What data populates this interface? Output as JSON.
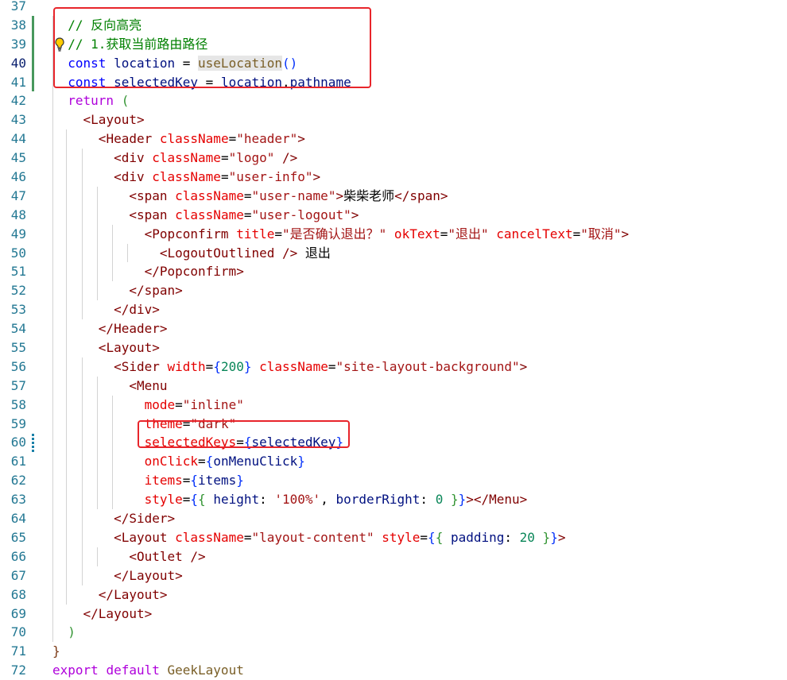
{
  "editor": {
    "lines": [
      {
        "n": "37",
        "tokens": []
      },
      {
        "n": "38",
        "tokens": [
          {
            "t": "// 反向高亮",
            "c": "cmt"
          }
        ]
      },
      {
        "n": "39",
        "tokens": [
          {
            "t": "// 1.获取当前路由路径",
            "c": "cmt"
          }
        ]
      },
      {
        "n": "40",
        "active": true,
        "tokens": [
          {
            "t": "const ",
            "c": "kw"
          },
          {
            "t": "location",
            "c": "var"
          },
          {
            "t": " = ",
            "c": "txt"
          },
          {
            "t": "useLocation",
            "c": "fn wordhl"
          },
          {
            "t": "()",
            "c": "br1"
          }
        ]
      },
      {
        "n": "41",
        "tokens": [
          {
            "t": "const ",
            "c": "kw"
          },
          {
            "t": "selectedKey",
            "c": "var"
          },
          {
            "t": " = ",
            "c": "txt"
          },
          {
            "t": "location",
            "c": "var"
          },
          {
            "t": ".",
            "c": "txt"
          },
          {
            "t": "pathname",
            "c": "var"
          }
        ]
      },
      {
        "n": "42",
        "tokens": [
          {
            "t": "return ",
            "c": "ctrl"
          },
          {
            "t": "(",
            "c": "br2"
          }
        ]
      },
      {
        "n": "43",
        "tokens": [
          {
            "t": "  <",
            "c": "tag"
          },
          {
            "t": "Layout",
            "c": "tag"
          },
          {
            "t": ">",
            "c": "tag"
          }
        ]
      },
      {
        "n": "44",
        "tokens": [
          {
            "t": "    <",
            "c": "tag"
          },
          {
            "t": "Header ",
            "c": "tag"
          },
          {
            "t": "className",
            "c": "attr"
          },
          {
            "t": "=",
            "c": "txt"
          },
          {
            "t": "\"header\"",
            "c": "str"
          },
          {
            "t": ">",
            "c": "tag"
          }
        ]
      },
      {
        "n": "45",
        "tokens": [
          {
            "t": "      <",
            "c": "tag"
          },
          {
            "t": "div ",
            "c": "tag"
          },
          {
            "t": "className",
            "c": "attr"
          },
          {
            "t": "=",
            "c": "txt"
          },
          {
            "t": "\"logo\"",
            "c": "str"
          },
          {
            "t": " />",
            "c": "tag"
          }
        ]
      },
      {
        "n": "46",
        "tokens": [
          {
            "t": "      <",
            "c": "tag"
          },
          {
            "t": "div ",
            "c": "tag"
          },
          {
            "t": "className",
            "c": "attr"
          },
          {
            "t": "=",
            "c": "txt"
          },
          {
            "t": "\"user-info\"",
            "c": "str"
          },
          {
            "t": ">",
            "c": "tag"
          }
        ]
      },
      {
        "n": "47",
        "tokens": [
          {
            "t": "        <",
            "c": "tag"
          },
          {
            "t": "span ",
            "c": "tag"
          },
          {
            "t": "className",
            "c": "attr"
          },
          {
            "t": "=",
            "c": "txt"
          },
          {
            "t": "\"user-name\"",
            "c": "str"
          },
          {
            "t": ">",
            "c": "tag"
          },
          {
            "t": "柴柴老师",
            "c": "txt"
          },
          {
            "t": "</",
            "c": "tag"
          },
          {
            "t": "span",
            "c": "tag"
          },
          {
            "t": ">",
            "c": "tag"
          }
        ]
      },
      {
        "n": "48",
        "tokens": [
          {
            "t": "        <",
            "c": "tag"
          },
          {
            "t": "span ",
            "c": "tag"
          },
          {
            "t": "className",
            "c": "attr"
          },
          {
            "t": "=",
            "c": "txt"
          },
          {
            "t": "\"user-logout\"",
            "c": "str"
          },
          {
            "t": ">",
            "c": "tag"
          }
        ]
      },
      {
        "n": "49",
        "tokens": [
          {
            "t": "          <",
            "c": "tag"
          },
          {
            "t": "Popconfirm ",
            "c": "tag"
          },
          {
            "t": "title",
            "c": "attr"
          },
          {
            "t": "=",
            "c": "txt"
          },
          {
            "t": "\"是否确认退出？\"",
            "c": "str"
          },
          {
            "t": " okText",
            "c": "attr"
          },
          {
            "t": "=",
            "c": "txt"
          },
          {
            "t": "\"退出\"",
            "c": "str"
          },
          {
            "t": " cancelText",
            "c": "attr"
          },
          {
            "t": "=",
            "c": "txt"
          },
          {
            "t": "\"取消\"",
            "c": "str"
          },
          {
            "t": ">",
            "c": "tag"
          }
        ]
      },
      {
        "n": "50",
        "tokens": [
          {
            "t": "            <",
            "c": "tag"
          },
          {
            "t": "LogoutOutlined ",
            "c": "tag"
          },
          {
            "t": "/>",
            "c": "tag"
          },
          {
            "t": " 退出",
            "c": "txt"
          }
        ]
      },
      {
        "n": "51",
        "tokens": [
          {
            "t": "          </",
            "c": "tag"
          },
          {
            "t": "Popconfirm",
            "c": "tag"
          },
          {
            "t": ">",
            "c": "tag"
          }
        ]
      },
      {
        "n": "52",
        "tokens": [
          {
            "t": "        </",
            "c": "tag"
          },
          {
            "t": "span",
            "c": "tag"
          },
          {
            "t": ">",
            "c": "tag"
          }
        ]
      },
      {
        "n": "53",
        "tokens": [
          {
            "t": "      </",
            "c": "tag"
          },
          {
            "t": "div",
            "c": "tag"
          },
          {
            "t": ">",
            "c": "tag"
          }
        ]
      },
      {
        "n": "54",
        "tokens": [
          {
            "t": "    </",
            "c": "tag"
          },
          {
            "t": "Header",
            "c": "tag"
          },
          {
            "t": ">",
            "c": "tag"
          }
        ]
      },
      {
        "n": "55",
        "tokens": [
          {
            "t": "    <",
            "c": "tag"
          },
          {
            "t": "Layout",
            "c": "tag"
          },
          {
            "t": ">",
            "c": "tag"
          }
        ]
      },
      {
        "n": "56",
        "tokens": [
          {
            "t": "      <",
            "c": "tag"
          },
          {
            "t": "Sider ",
            "c": "tag"
          },
          {
            "t": "width",
            "c": "attr"
          },
          {
            "t": "=",
            "c": "txt"
          },
          {
            "t": "{",
            "c": "br1"
          },
          {
            "t": "200",
            "c": "num"
          },
          {
            "t": "}",
            "c": "br1"
          },
          {
            "t": " className",
            "c": "attr"
          },
          {
            "t": "=",
            "c": "txt"
          },
          {
            "t": "\"site-layout-background\"",
            "c": "str"
          },
          {
            "t": ">",
            "c": "tag"
          }
        ]
      },
      {
        "n": "57",
        "tokens": [
          {
            "t": "        <",
            "c": "tag"
          },
          {
            "t": "Menu",
            "c": "tag"
          }
        ]
      },
      {
        "n": "58",
        "tokens": [
          {
            "t": "          mode",
            "c": "attr"
          },
          {
            "t": "=",
            "c": "txt"
          },
          {
            "t": "\"inline\"",
            "c": "str"
          }
        ]
      },
      {
        "n": "59",
        "tokens": [
          {
            "t": "          theme",
            "c": "attr"
          },
          {
            "t": "=",
            "c": "txt"
          },
          {
            "t": "\"dark\"",
            "c": "str"
          }
        ]
      },
      {
        "n": "60",
        "tokens": [
          {
            "t": "          selectedKeys",
            "c": "attr"
          },
          {
            "t": "=",
            "c": "txt"
          },
          {
            "t": "{",
            "c": "br1"
          },
          {
            "t": "selectedKey",
            "c": "var"
          },
          {
            "t": "}",
            "c": "br1"
          }
        ]
      },
      {
        "n": "61",
        "tokens": [
          {
            "t": "          onClick",
            "c": "attr"
          },
          {
            "t": "=",
            "c": "txt"
          },
          {
            "t": "{",
            "c": "br1"
          },
          {
            "t": "onMenuClick",
            "c": "var"
          },
          {
            "t": "}",
            "c": "br1"
          }
        ]
      },
      {
        "n": "62",
        "tokens": [
          {
            "t": "          items",
            "c": "attr"
          },
          {
            "t": "=",
            "c": "txt"
          },
          {
            "t": "{",
            "c": "br1"
          },
          {
            "t": "items",
            "c": "var"
          },
          {
            "t": "}",
            "c": "br1"
          }
        ]
      },
      {
        "n": "63",
        "tokens": [
          {
            "t": "          style",
            "c": "attr"
          },
          {
            "t": "=",
            "c": "txt"
          },
          {
            "t": "{",
            "c": "br1"
          },
          {
            "t": "{",
            "c": "br2"
          },
          {
            "t": " height",
            "c": "var"
          },
          {
            "t": ": ",
            "c": "txt"
          },
          {
            "t": "'100%'",
            "c": "str"
          },
          {
            "t": ", ",
            "c": "txt"
          },
          {
            "t": "borderRight",
            "c": "var"
          },
          {
            "t": ": ",
            "c": "txt"
          },
          {
            "t": "0",
            "c": "num"
          },
          {
            "t": " }",
            "c": "br2"
          },
          {
            "t": "}",
            "c": "br1"
          },
          {
            "t": "></",
            "c": "tag"
          },
          {
            "t": "Menu",
            "c": "tag"
          },
          {
            "t": ">",
            "c": "tag"
          }
        ]
      },
      {
        "n": "64",
        "tokens": [
          {
            "t": "      </",
            "c": "tag"
          },
          {
            "t": "Sider",
            "c": "tag"
          },
          {
            "t": ">",
            "c": "tag"
          }
        ]
      },
      {
        "n": "65",
        "tokens": [
          {
            "t": "      <",
            "c": "tag"
          },
          {
            "t": "Layout ",
            "c": "tag"
          },
          {
            "t": "className",
            "c": "attr"
          },
          {
            "t": "=",
            "c": "txt"
          },
          {
            "t": "\"layout-content\"",
            "c": "str"
          },
          {
            "t": " style",
            "c": "attr"
          },
          {
            "t": "=",
            "c": "txt"
          },
          {
            "t": "{",
            "c": "br1"
          },
          {
            "t": "{",
            "c": "br2"
          },
          {
            "t": " padding",
            "c": "var"
          },
          {
            "t": ": ",
            "c": "txt"
          },
          {
            "t": "20",
            "c": "num"
          },
          {
            "t": " }",
            "c": "br2"
          },
          {
            "t": "}",
            "c": "br1"
          },
          {
            "t": ">",
            "c": "tag"
          }
        ]
      },
      {
        "n": "66",
        "tokens": [
          {
            "t": "        <",
            "c": "tag"
          },
          {
            "t": "Outlet ",
            "c": "tag"
          },
          {
            "t": "/>",
            "c": "tag"
          }
        ]
      },
      {
        "n": "67",
        "tokens": [
          {
            "t": "      </",
            "c": "tag"
          },
          {
            "t": "Layout",
            "c": "tag"
          },
          {
            "t": ">",
            "c": "tag"
          }
        ]
      },
      {
        "n": "68",
        "tokens": [
          {
            "t": "    </",
            "c": "tag"
          },
          {
            "t": "Layout",
            "c": "tag"
          },
          {
            "t": ">",
            "c": "tag"
          }
        ]
      },
      {
        "n": "69",
        "tokens": [
          {
            "t": "  </",
            "c": "tag"
          },
          {
            "t": "Layout",
            "c": "tag"
          },
          {
            "t": ">",
            "c": "tag"
          }
        ]
      },
      {
        "n": "70",
        "tokens": [
          {
            "t": ")",
            "c": "br2"
          }
        ]
      },
      {
        "n": "71",
        "indent": 0,
        "tokens": [
          {
            "t": "}",
            "c": "br3"
          }
        ]
      },
      {
        "n": "72",
        "indent": 0,
        "tokens": [
          {
            "t": "export ",
            "c": "ctrl"
          },
          {
            "t": "default ",
            "c": "ctrl"
          },
          {
            "t": "GeekLayout",
            "c": "fn"
          }
        ]
      }
    ]
  },
  "icons": {
    "lightbulb": "lightbulb-icon"
  },
  "colors": {
    "highlight_box": "#e8252b",
    "line_number": "#237893",
    "active_line_number": "#0b216f",
    "git_added": "#48985d",
    "git_modified": "#1b81a8"
  }
}
